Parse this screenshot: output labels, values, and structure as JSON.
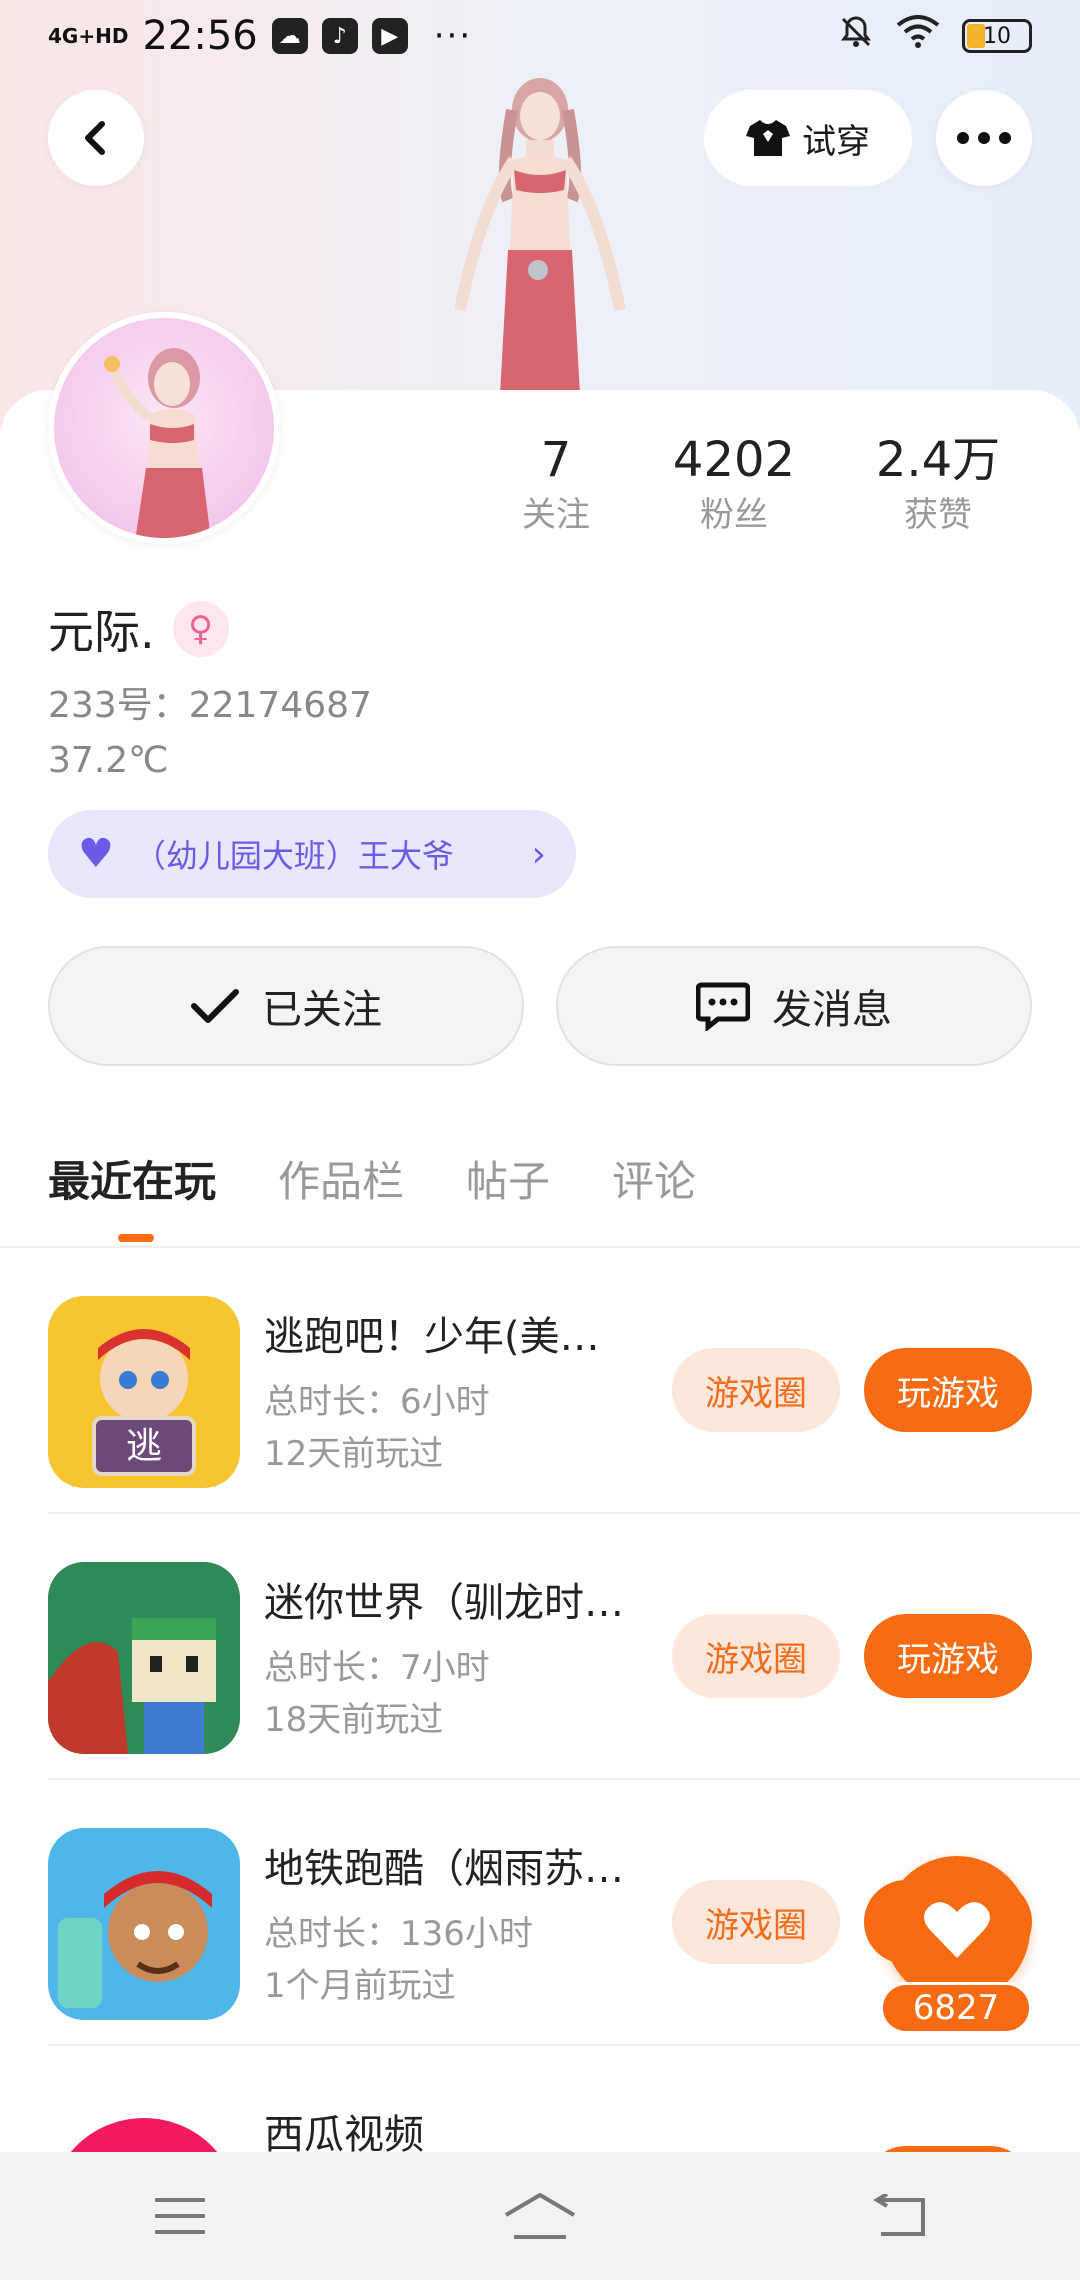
{
  "status_bar": {
    "network": "4G+HD",
    "time": "22:56",
    "dots": "···",
    "battery": "10"
  },
  "header": {
    "try_on_label": "试穿"
  },
  "profile": {
    "stats": [
      {
        "value": "7",
        "label": "关注"
      },
      {
        "value": "4202",
        "label": "粉丝"
      },
      {
        "value": "2.4万",
        "label": "获赞"
      }
    ],
    "name": "元际.",
    "gender_symbol": "♀",
    "uid": "233号：22174687",
    "temperature": "37.2℃",
    "title_badge": "（幼儿园大班）王大爷"
  },
  "actions": {
    "follow_label": "已关注",
    "message_label": "发消息"
  },
  "tabs": [
    {
      "label": "最近在玩",
      "active": true
    },
    {
      "label": "作品栏",
      "active": false
    },
    {
      "label": "帖子",
      "active": false
    },
    {
      "label": "评论",
      "active": false
    }
  ],
  "games": [
    {
      "name": "逃跑吧！少年(美…",
      "duration": "总时长：6小时",
      "last_played": "12天前玩过",
      "circle_label": "游戏圈",
      "play_label": "玩游戏"
    },
    {
      "name": "迷你世界（驯龙时…",
      "duration": "总时长：7小时",
      "last_played": "18天前玩过",
      "circle_label": "游戏圈",
      "play_label": "玩游戏"
    },
    {
      "name": "地铁跑酷（烟雨苏…",
      "duration": "总时长：136小时",
      "last_played": "1个月前玩过",
      "circle_label": "游戏圈",
      "play_label": "玩游戏"
    },
    {
      "name": "西瓜视频",
      "duration": "",
      "last_played": "",
      "circle_label": "",
      "play_label": ""
    }
  ],
  "like": {
    "count": "6827"
  },
  "colors": {
    "accent_orange": "#f76b12",
    "badge_purple": "#6b5ce7"
  }
}
